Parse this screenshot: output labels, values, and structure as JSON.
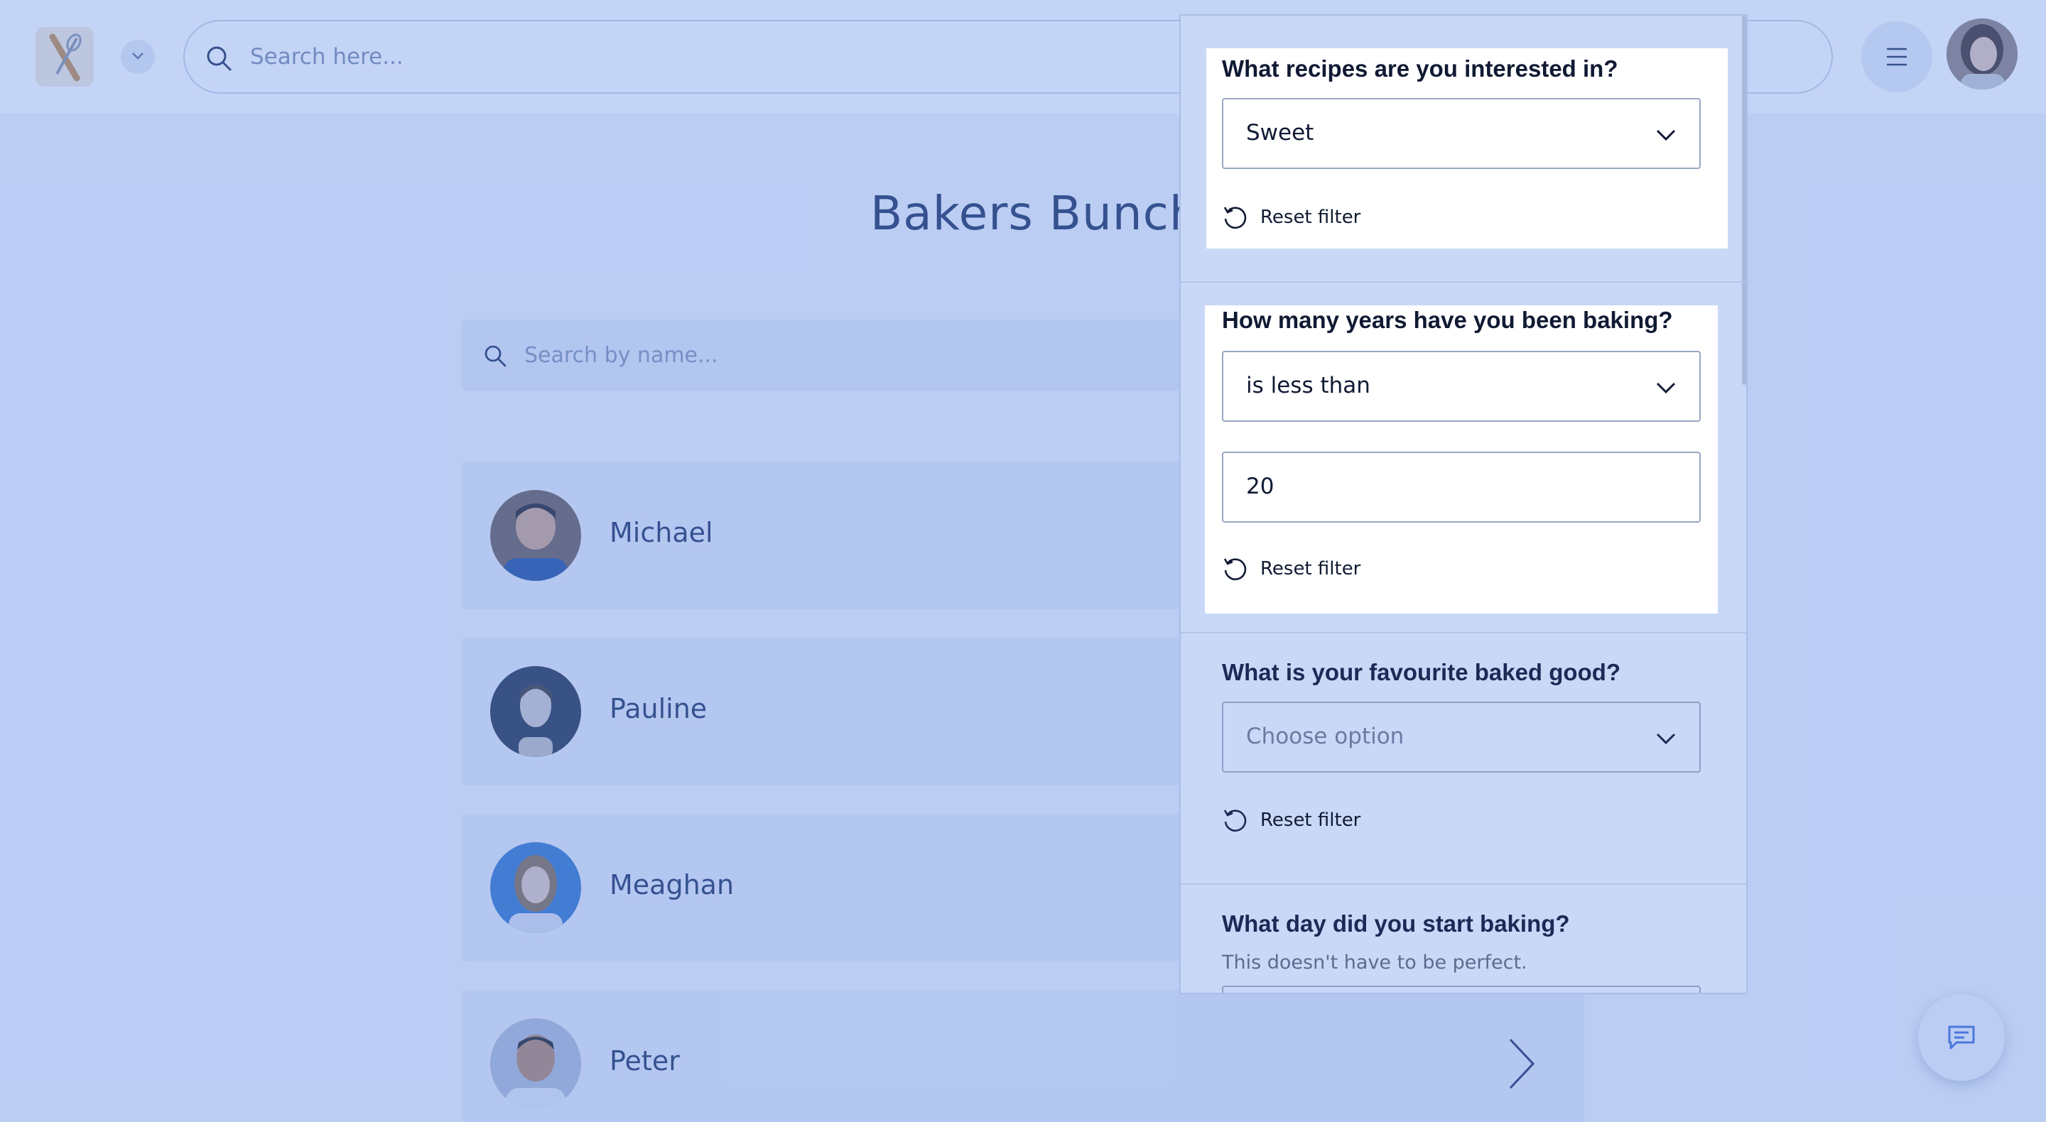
{
  "header": {
    "search_placeholder": "Search here...",
    "logo_icon": "rolling-pin-whisk-icon",
    "menu_icon": "hamburger-icon"
  },
  "page": {
    "title": "Bakers Bunch",
    "name_search_placeholder": "Search by name..."
  },
  "members": [
    {
      "name": "Michael"
    },
    {
      "name": "Pauline"
    },
    {
      "name": "Meaghan"
    },
    {
      "name": "Peter"
    }
  ],
  "filters": [
    {
      "question": "What recipes are you interested in?",
      "select_value": "Sweet",
      "reset_label": "Reset filter"
    },
    {
      "question": "How many years have you been baking?",
      "select_value": "is less than",
      "input_value": "20",
      "reset_label": "Reset filter"
    },
    {
      "question": "What is your favourite baked good?",
      "select_placeholder": "Choose option",
      "reset_label": "Reset filter"
    },
    {
      "question": "What day did you start baking?",
      "hint": "This doesn't have to be perfect."
    }
  ],
  "colors": {
    "overlay": "#628ee8",
    "panel": "#c9d8f7",
    "text_dark": "#111a33",
    "brand_text": "#1b2a55"
  },
  "icons": {
    "chat": "chat-bubble-icon",
    "reset": "reset-rotate-icon",
    "chevron": "chevron-down-icon"
  }
}
